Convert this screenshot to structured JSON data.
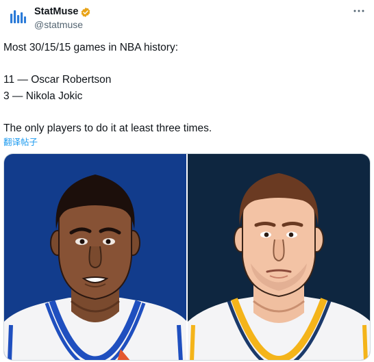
{
  "tweet": {
    "author": {
      "display_name": "StatMuse",
      "handle": "@statmuse",
      "verified_badge_color": "#e8a317"
    },
    "text_lines": [
      "Most 30/15/15 games in NBA history:",
      "11 — Oscar Robertson",
      "3 — Nikola Jokic",
      "The only players to do it at least three times."
    ],
    "translate_label": "翻译帖子",
    "icons": {
      "more": "more-horizontal-icon",
      "verified": "verified-badge-icon",
      "avatar": "statmuse-logo-icon"
    }
  },
  "colors": {
    "link": "#1d9bf0",
    "secondary_text": "#536471",
    "left_panel_bg": "#123c8c",
    "right_panel_bg": "#0e2640"
  }
}
